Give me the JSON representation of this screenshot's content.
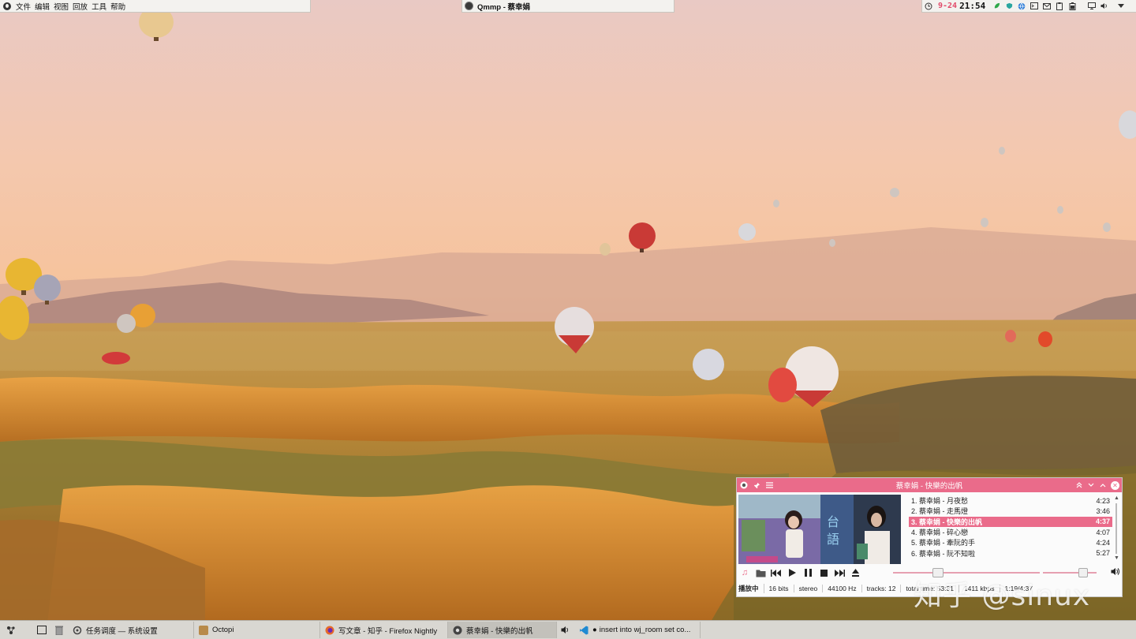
{
  "topbar": {
    "menu": [
      "文件",
      "编辑",
      "视图",
      "回放",
      "工具",
      "帮助"
    ],
    "active_window_title": "Qmmp - 蔡幸娟",
    "tray": {
      "date": "9-24",
      "time": "21:54",
      "icons": [
        "leaf-icon",
        "shield-icon",
        "globe-icon",
        "terminal-icon",
        "mail-icon",
        "clipboard-icon",
        "battery-icon",
        "display-icon",
        "volume-icon",
        "chevron-down-icon"
      ]
    }
  },
  "player": {
    "title": "蔡幸娟 - 快樂的出帆",
    "playlist": [
      {
        "label": "1. 蔡幸娟 - 月夜愁",
        "duration": "4:23"
      },
      {
        "label": "2. 蔡幸娟 - 走馬燈",
        "duration": "3:46"
      },
      {
        "label": "3. 蔡幸娟 - 快樂的出帆",
        "duration": "4:37",
        "active": true
      },
      {
        "label": "4. 蔡幸娟 - 碎心戀",
        "duration": "4:07"
      },
      {
        "label": "5. 蔡幸娟 - 牽阮的手",
        "duration": "4:24"
      },
      {
        "label": "6. 蔡幸娟 - 阮不知啦",
        "duration": "5:27"
      }
    ],
    "status": {
      "state": "播放中",
      "bits": "16 bits",
      "channels": "stereo",
      "rate": "44100 Hz",
      "tracks": "tracks: 12",
      "total_time": "total time: 53:31",
      "bitrate": "1411 kbps",
      "elapsed": "1:19/4:37"
    },
    "seek_fraction": 0.29,
    "volume_fraction": 0.8,
    "accent_color": "#ea6b8a"
  },
  "watermark": "知乎 @sinux",
  "taskbar": {
    "tasks": [
      {
        "label": "任务调度 — 系统设置",
        "icon": "settings-icon"
      },
      {
        "label": "Octopi",
        "icon": "package-icon"
      },
      {
        "label": "写文章 - 知乎 - Firefox Nightly",
        "icon": "firefox-icon"
      },
      {
        "label": "蔡幸娟 - 快樂的出帆",
        "icon": "qmmp-icon",
        "active": true
      },
      {
        "label": "insert into wj_room set co...",
        "icon": "vscode-icon"
      }
    ]
  }
}
